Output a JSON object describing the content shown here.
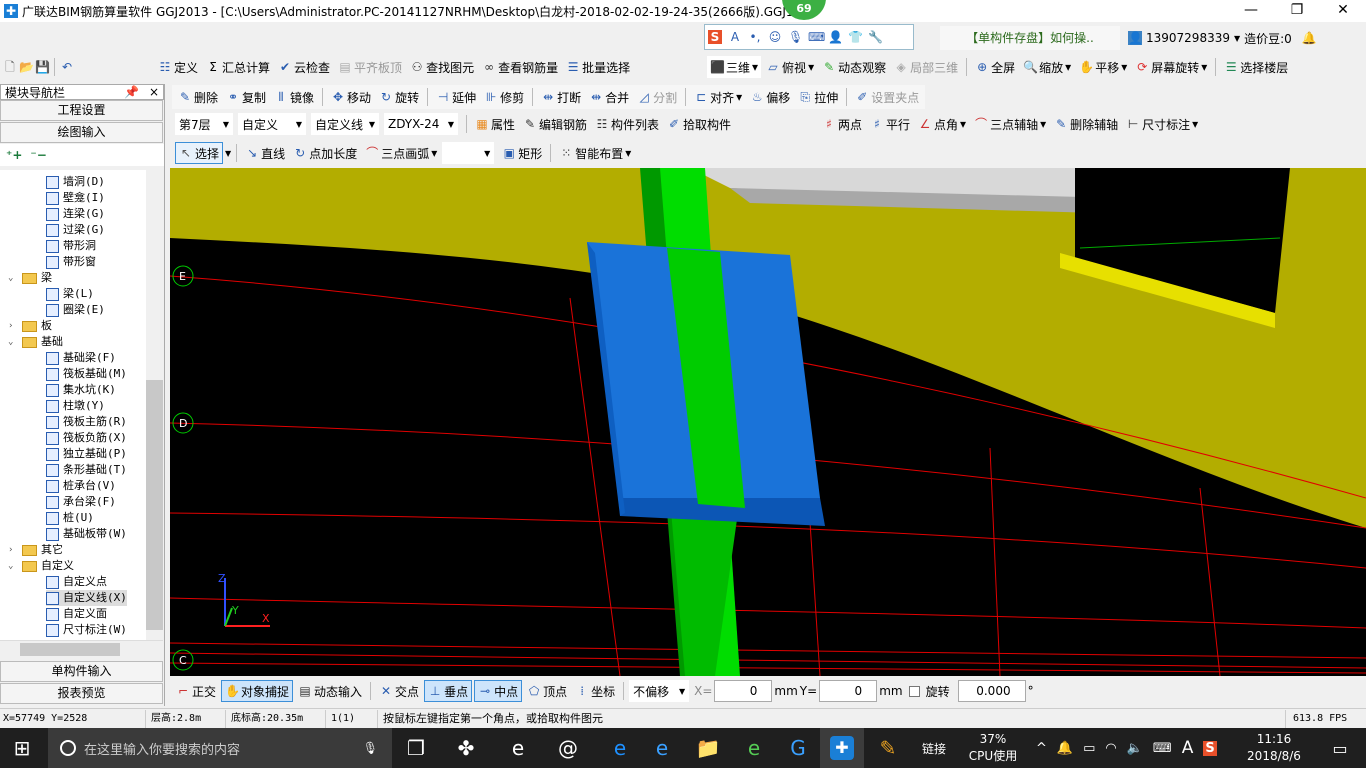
{
  "title": "广联达BIM钢筋算量软件 GGJ2013 - [C:\\Users\\Administrator.PC-20141127NRHM\\Desktop\\白龙村-2018-02-02-19-24-35(2666版).GGJ12]",
  "badge": "69",
  "ime_bar": {
    "icons": [
      "sogou-icon",
      "a-icon",
      "punct-icon",
      "smile-icon",
      "mic-icon",
      "keyboard-icon",
      "user-icon",
      "shirt-icon",
      "wrench-icon"
    ]
  },
  "tip": "【单构件存盘】如何操..",
  "user": {
    "phone": "13907298339",
    "beans": "造价豆:0"
  },
  "toolbar1": {
    "items": [
      "定义",
      "汇总计算",
      "云检查",
      "平齐板顶",
      "查找图元",
      "查看钢筋量",
      "批量选择"
    ]
  },
  "toolbar1b": {
    "items": [
      "三维",
      "俯视",
      "动态观察",
      "局部三维",
      "全屏",
      "缩放",
      "平移",
      "屏幕旋转",
      "选择楼层"
    ]
  },
  "nav": {
    "title": "模块导航栏",
    "pin": "ᵖ",
    "close": "×",
    "project_settings": "工程设置",
    "drawing_input": "绘图输入",
    "single_input": "单构件输入",
    "report_preview": "报表预览"
  },
  "toolbar2": {
    "items": [
      "删除",
      "复制",
      "镜像",
      "移动",
      "旋转",
      "延伸",
      "修剪",
      "打断",
      "合并",
      "分割",
      "对齐",
      "偏移",
      "拉伸",
      "设置夹点"
    ]
  },
  "toolbar3": {
    "floor": "第7层",
    "type": "自定义",
    "subtype": "自定义线",
    "name": "ZDYX-24",
    "items": [
      "属性",
      "编辑钢筋",
      "构件列表",
      "拾取构件"
    ],
    "right": [
      "两点",
      "平行",
      "点角",
      "三点辅轴",
      "删除辅轴",
      "尺寸标注"
    ]
  },
  "toolbar4": {
    "items": [
      "选择",
      "直线",
      "点加长度",
      "三点画弧",
      "",
      "矩形",
      "智能布置"
    ]
  },
  "tree": [
    {
      "label": "墙洞(D)",
      "level": 2
    },
    {
      "label": "壁龛(I)",
      "level": 2
    },
    {
      "label": "连梁(G)",
      "level": 2
    },
    {
      "label": "过梁(G)",
      "level": 2
    },
    {
      "label": "带形洞",
      "level": 2
    },
    {
      "label": "带形窗",
      "level": 2
    },
    {
      "label": "梁",
      "level": 1,
      "open": true
    },
    {
      "label": "梁(L)",
      "level": 2
    },
    {
      "label": "圈梁(E)",
      "level": 2
    },
    {
      "label": "板",
      "level": 1,
      "open": false
    },
    {
      "label": "基础",
      "level": 1,
      "open": true
    },
    {
      "label": "基础梁(F)",
      "level": 2
    },
    {
      "label": "筏板基础(M)",
      "level": 2
    },
    {
      "label": "集水坑(K)",
      "level": 2
    },
    {
      "label": "柱墩(Y)",
      "level": 2
    },
    {
      "label": "筏板主筋(R)",
      "level": 2
    },
    {
      "label": "筏板负筋(X)",
      "level": 2
    },
    {
      "label": "独立基础(P)",
      "level": 2
    },
    {
      "label": "条形基础(T)",
      "level": 2
    },
    {
      "label": "桩承台(V)",
      "level": 2
    },
    {
      "label": "承台梁(F)",
      "level": 2
    },
    {
      "label": "桩(U)",
      "level": 2
    },
    {
      "label": "基础板带(W)",
      "level": 2
    },
    {
      "label": "其它",
      "level": 1,
      "open": false
    },
    {
      "label": "自定义",
      "level": 1,
      "open": true
    },
    {
      "label": "自定义点",
      "level": 2
    },
    {
      "label": "自定义线(X)",
      "level": 2,
      "selected": true
    },
    {
      "label": "自定义面",
      "level": 2
    },
    {
      "label": "尺寸标注(W)",
      "level": 2
    }
  ],
  "axes": {
    "grid_labels": [
      "E",
      "D",
      "C"
    ],
    "z": "Z",
    "y": "Y",
    "x": "X"
  },
  "snap": {
    "items": [
      "正交",
      "对象捕捉",
      "动态输入",
      "交点",
      "垂点",
      "中点",
      "顶点",
      "坐标"
    ],
    "active": [
      "对象捕捉",
      "垂点",
      "中点"
    ],
    "offset": "不偏移",
    "x_label": "X=",
    "x_value": "0",
    "y_label": "Y=",
    "y_value": "0",
    "unit": "mm",
    "rotate": "旋转",
    "rotate_value": "0.000",
    "degree": "°"
  },
  "status": {
    "coords": "X=57749 Y=2528",
    "floor_height": "层高:2.8m",
    "base_height": "底标高:20.35m",
    "count": "1(1)",
    "hint": "按鼠标左键指定第一个角点，或拾取构件图元",
    "fps": "613.8 FPS"
  },
  "taskbar": {
    "search_placeholder": "在这里输入你要搜索的内容",
    "link": "链接",
    "cpu_pct": "37%",
    "cpu_label": "CPU使用",
    "time": "11:16",
    "date": "2018/8/6",
    "ime": "A"
  },
  "colors": {
    "yellow": "#b3ad00",
    "green": "#00cc00",
    "blue": "#1a73d9",
    "grid": "#ff0000"
  }
}
